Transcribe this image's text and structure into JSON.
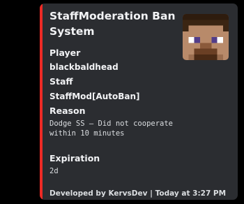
{
  "embed": {
    "title": "StaffModeration Ban System",
    "accent_color": "#ed2a25",
    "thumbnail_icon": "minecraft-steve-head-icon",
    "fields": [
      {
        "name": "Player",
        "value": "blackbaldhead"
      },
      {
        "name": "Staff",
        "value": "StaffMod[AutoBan]"
      },
      {
        "name": "Reason",
        "value": "Dodge SS — Did not cooperate within 10 minutes"
      },
      {
        "name": "Expiration",
        "value": "2d"
      }
    ],
    "footer": "Developed by KervsDev | Today at 3:27 PM"
  }
}
